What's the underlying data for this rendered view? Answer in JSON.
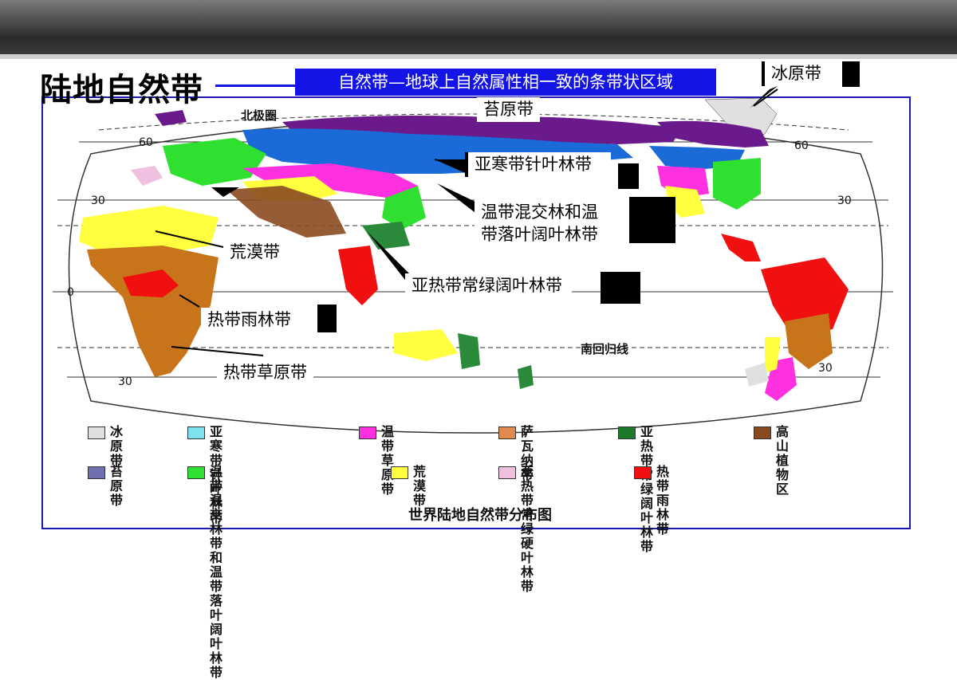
{
  "page": {
    "title": "陆地自然带",
    "definition": "自然带—地球上自然属性相一致的条带状区域",
    "map_caption": "世界陆地自然带分布图"
  },
  "map_labels": {
    "arctic_circle": "北极圈",
    "tropic_capricorn": "南回归线",
    "lat_60_left": "60",
    "lat_30_left": "30",
    "lat_0_left": "0",
    "lat_30s_left": "30",
    "lat_60_right": "60",
    "lat_30_right": "30",
    "lat_30s_right": "30"
  },
  "callouts": {
    "ice": "冰原带",
    "tundra": "苔原带",
    "taiga": "亚寒带针叶林带",
    "temperate_mixed": "温带混交林和温带落叶阔叶林带",
    "temperate_mixed_line1": "温带混交林和温",
    "temperate_mixed_line2": "带落叶阔叶林带",
    "desert": "荒漠带",
    "subtropical": "亚热带常绿阔叶林带",
    "rainforest": "热带雨林带",
    "savanna": "热带草原带"
  },
  "legend": [
    {
      "label": "冰原带",
      "color": "#e0e0e0"
    },
    {
      "label": "亚寒带针叶林带",
      "color": "#7fe0f0"
    },
    {
      "label": "温带草原带",
      "color": "#ff30e0"
    },
    {
      "label": "萨瓦纳带",
      "color": "#e08a50"
    },
    {
      "label": "亚热带常绿",
      "label2": "阔叶林带",
      "color": "#1a7a2a"
    },
    {
      "label": "高山植物区",
      "color": "#8a4a20"
    },
    {
      "label": "苔原带",
      "color": "#7070b0"
    },
    {
      "label": "温带混交林带和温带",
      "label2": "落叶阔叶林带",
      "color": "#30e030"
    },
    {
      "label": "荒漠带",
      "color": "#ffff40"
    },
    {
      "label": "亚热带常绿",
      "label2": "硬叶林带",
      "color": "#f0c0e0"
    },
    {
      "label": "热带雨林带",
      "color": "#f01010"
    }
  ],
  "colors": {
    "ice": "#e0e0e0",
    "tundra": "#6a1a8a",
    "taiga": "#1a6ad8",
    "temperate_forest": "#30e030",
    "steppe": "#ff30e0",
    "desert": "#ffff40",
    "savanna": "#c8741a",
    "rainforest": "#f01010",
    "subtropical": "#2a8a3a",
    "highland": "#8a4a20",
    "mediterranean": "#f0c0e0",
    "definition_bg": "#1414e6"
  }
}
